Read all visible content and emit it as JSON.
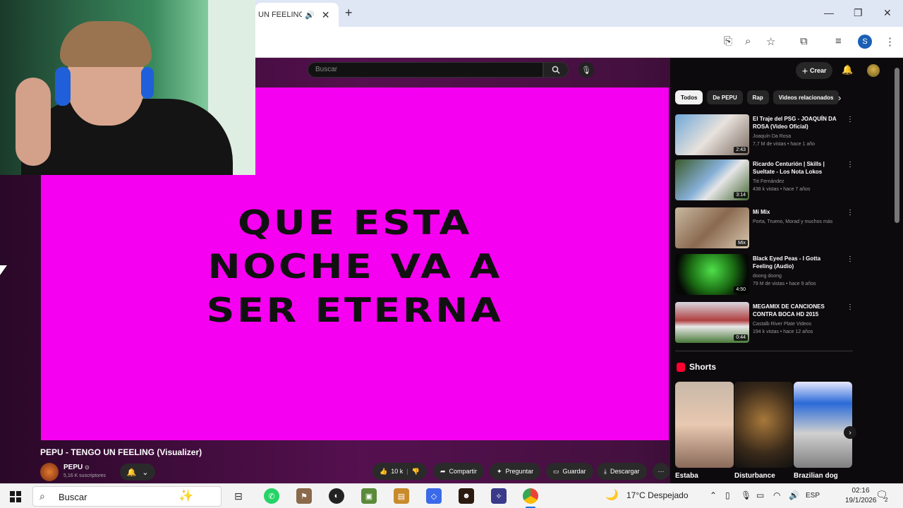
{
  "browser": {
    "tab_title": "UN FEELING",
    "tab_speaker_icon": "speaker-icon",
    "tab_close": "✕",
    "new_tab": "+"
  },
  "youtube": {
    "search_placeholder": "Buscar",
    "create_label": "Crear",
    "lyrics": [
      "QUE ESTA",
      "NOCHE VA A",
      "SER ETERNA"
    ],
    "video_title": "PEPU - TENGO UN FEELING (Visualizer)",
    "channel_name": "PEPU",
    "channel_subs": "5,16 K suscriptores",
    "like_count": "10 k",
    "actions": {
      "share": "Compartir",
      "ask": "Preguntar",
      "save": "Guardar",
      "download": "Descargar"
    },
    "chips": [
      "Todos",
      "De PEPU",
      "Rap",
      "Videos relacionados"
    ],
    "recommendations": [
      {
        "title": "El Traje del PSG - JOAQUÍN DA ROSA (Video Oficial)",
        "channel": "Joaquín Da Rosa",
        "meta": "7,7 M de vistas • hace 1 año",
        "duration": "2:43"
      },
      {
        "title": "Ricardo Centurión | Skills | Sueltate - Los Nota Lokos",
        "channel": "Titi Fernández",
        "meta": "438 k vistas • hace 7 años",
        "duration": "3:14"
      },
      {
        "title": "Mi Mix",
        "channel": "Porta, Trueno, Morad y muchos más",
        "meta": "",
        "duration": "Mix"
      },
      {
        "title": "Black Eyed Peas - I Gotta Feeling (Audio)",
        "channel": "doong doong",
        "meta": "79 M de vistas • hace 9 años",
        "duration": "4:50"
      },
      {
        "title": "MEGAMIX DE CANCIONES CONTRA BOCA HD 2015",
        "channel": "Castalb River Plate Videos",
        "meta": "194 k vistas • hace 12 años",
        "duration": "0:44"
      }
    ],
    "shorts_label": "Shorts",
    "shorts": [
      "Estaba",
      "Disturbance",
      "Brazilian dog"
    ]
  },
  "taskbar": {
    "search_text": "Buscar",
    "weather": "17°C  Despejado",
    "language": "ESP",
    "time": "02:16",
    "date": "19/1/2026",
    "notification_count": "2"
  },
  "colors": {
    "video_bg": "#f500f0",
    "page_purple": "#55104f",
    "yt_dark": "#0d0a0d"
  }
}
